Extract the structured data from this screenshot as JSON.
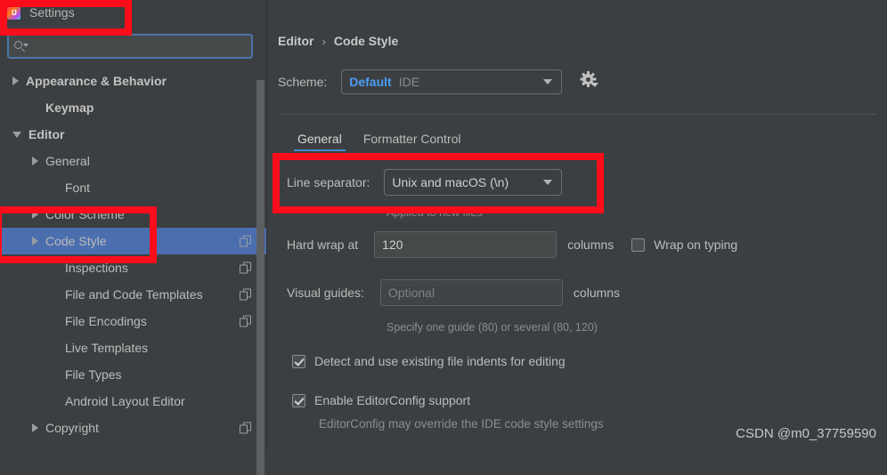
{
  "window": {
    "title": "Settings",
    "app_icon": "intellij-idea-icon"
  },
  "search": {
    "value": "",
    "placeholder": "",
    "icon": "search-icon"
  },
  "sidebar": {
    "items": [
      {
        "label": "Appearance & Behavior",
        "arrow": "right",
        "bold": true,
        "indent": 14,
        "selected": false,
        "badge": false
      },
      {
        "label": "Keymap",
        "arrow": "none",
        "bold": true,
        "indent": 36,
        "selected": false,
        "badge": false
      },
      {
        "label": "Editor",
        "arrow": "down",
        "bold": true,
        "indent": 14,
        "selected": false,
        "badge": false
      },
      {
        "label": "General",
        "arrow": "right",
        "bold": false,
        "indent": 36,
        "selected": false,
        "badge": false
      },
      {
        "label": "Font",
        "arrow": "none",
        "bold": false,
        "indent": 58,
        "selected": false,
        "badge": false
      },
      {
        "label": "Color Scheme",
        "arrow": "right",
        "bold": false,
        "indent": 36,
        "selected": false,
        "badge": false
      },
      {
        "label": "Code Style",
        "arrow": "right",
        "bold": false,
        "indent": 36,
        "selected": true,
        "badge": true
      },
      {
        "label": "Inspections",
        "arrow": "none",
        "bold": false,
        "indent": 58,
        "selected": false,
        "badge": true
      },
      {
        "label": "File and Code Templates",
        "arrow": "none",
        "bold": false,
        "indent": 58,
        "selected": false,
        "badge": true
      },
      {
        "label": "File Encodings",
        "arrow": "none",
        "bold": false,
        "indent": 58,
        "selected": false,
        "badge": true
      },
      {
        "label": "Live Templates",
        "arrow": "none",
        "bold": false,
        "indent": 58,
        "selected": false,
        "badge": false
      },
      {
        "label": "File Types",
        "arrow": "none",
        "bold": false,
        "indent": 58,
        "selected": false,
        "badge": false
      },
      {
        "label": "Android Layout Editor",
        "arrow": "none",
        "bold": false,
        "indent": 58,
        "selected": false,
        "badge": false
      },
      {
        "label": "Copyright",
        "arrow": "right",
        "bold": false,
        "indent": 36,
        "selected": false,
        "badge": true
      }
    ]
  },
  "main": {
    "breadcrumb": {
      "root": "Editor",
      "separator": "›",
      "leaf": "Code Style"
    },
    "scheme": {
      "label": "Scheme:",
      "value": "Default",
      "scope": "IDE",
      "gear_icon": "gear-icon",
      "dropdown_icon": "chevron-down-icon"
    },
    "tabs": [
      {
        "label": "General",
        "active": true
      },
      {
        "label": "Formatter Control",
        "active": false
      }
    ],
    "line_separator": {
      "label": "Line separator:",
      "value": "Unix and macOS (\\n)",
      "hint": "Applied to new files"
    },
    "hard_wrap": {
      "label": "Hard wrap at",
      "value": "120",
      "unit": "columns",
      "wrap_on_typing": {
        "label": "Wrap on typing",
        "checked": false
      }
    },
    "visual_guides": {
      "label": "Visual guides:",
      "value": "",
      "placeholder": "Optional",
      "unit": "columns",
      "hint": "Specify one guide (80) or several (80, 120)"
    },
    "checkboxes": [
      {
        "label": "Detect and use existing file indents for editing",
        "checked": true
      },
      {
        "label": "Enable EditorConfig support",
        "checked": true
      }
    ],
    "editorconfig_hint": "EditorConfig may override the IDE code style settings"
  },
  "watermark": "CSDN @m0_37759590",
  "annotations": {
    "highlight_color": "#fc0d1b",
    "boxes": [
      "settings-title",
      "code-style-tree-item",
      "line-separator-row"
    ]
  },
  "colors": {
    "background": "#3c3f41",
    "selection": "#4b6eaf",
    "accent_link": "#4a9cf6",
    "focus_border": "#4a76a8"
  }
}
